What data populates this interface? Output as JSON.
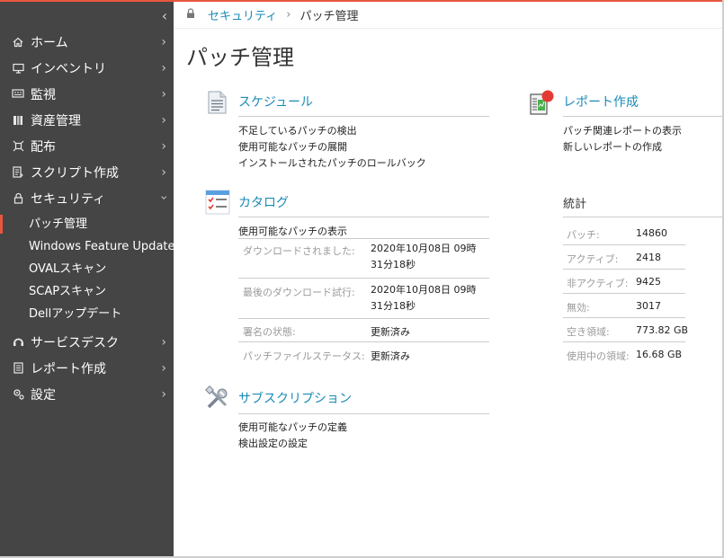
{
  "sidebar": {
    "collapse_glyph": "‹",
    "items": [
      {
        "label": "ホーム",
        "icon": "home-icon"
      },
      {
        "label": "インベントリ",
        "icon": "monitor-icon"
      },
      {
        "label": "監視",
        "icon": "monitoring-icon"
      },
      {
        "label": "資産管理",
        "icon": "assets-icon"
      },
      {
        "label": "配布",
        "icon": "distribution-icon"
      },
      {
        "label": "スクリプト作成",
        "icon": "scripting-icon"
      },
      {
        "label": "セキュリティ",
        "icon": "lock-icon"
      },
      {
        "label": "サービスデスク",
        "icon": "service-desk-icon"
      },
      {
        "label": "レポート作成",
        "icon": "reporting-icon"
      },
      {
        "label": "設定",
        "icon": "settings-icon"
      }
    ],
    "security_subitems": [
      {
        "label": "パッチ管理",
        "active": true
      },
      {
        "label": "Windows Feature Update",
        "active": false
      },
      {
        "label": "OVALスキャン",
        "active": false
      },
      {
        "label": "SCAPスキャン",
        "active": false
      },
      {
        "label": "Dellアップデート",
        "active": false
      }
    ]
  },
  "breadcrumb": {
    "parent": "セキュリティ",
    "separator": "›",
    "current": "パッチ管理"
  },
  "page_title": "パッチ管理",
  "schedule": {
    "title": "スケジュール",
    "links": [
      "不足しているパッチの検出",
      "使用可能なパッチの展開",
      "インストールされたパッチのロールバック"
    ]
  },
  "reporting": {
    "title": "レポート作成",
    "links": [
      "パッチ関連レポートの表示",
      "新しいレポートの作成"
    ]
  },
  "catalog": {
    "title": "カタログ",
    "link": "使用可能なパッチの表示",
    "rows": [
      {
        "label": "ダウンロードされました:",
        "value": "2020年10月08日 09時31分18秒"
      },
      {
        "label": "最後のダウンロード試行:",
        "value": "2020年10月08日 09時31分18秒"
      },
      {
        "label": "署名の状態:",
        "value": "更新済み"
      },
      {
        "label": "パッチファイルステータス:",
        "value": "更新済み"
      }
    ]
  },
  "subscription": {
    "title": "サブスクリプション",
    "links": [
      "使用可能なパッチの定義",
      "検出設定の設定"
    ]
  },
  "stats": {
    "title": "統計",
    "rows": [
      {
        "label": "パッチ:",
        "value": "14860"
      },
      {
        "label": "アクティブ:",
        "value": "2418"
      },
      {
        "label": "非アクティブ:",
        "value": "9425"
      },
      {
        "label": "無効:",
        "value": "3017"
      },
      {
        "label": "空き領域:",
        "value": "773.82 GB"
      },
      {
        "label": "使用中の領域:",
        "value": "16.68 GB"
      }
    ]
  },
  "colors": {
    "accent": "#e9573f",
    "link": "#1a8bb6",
    "sidebar_bg": "#454545"
  }
}
